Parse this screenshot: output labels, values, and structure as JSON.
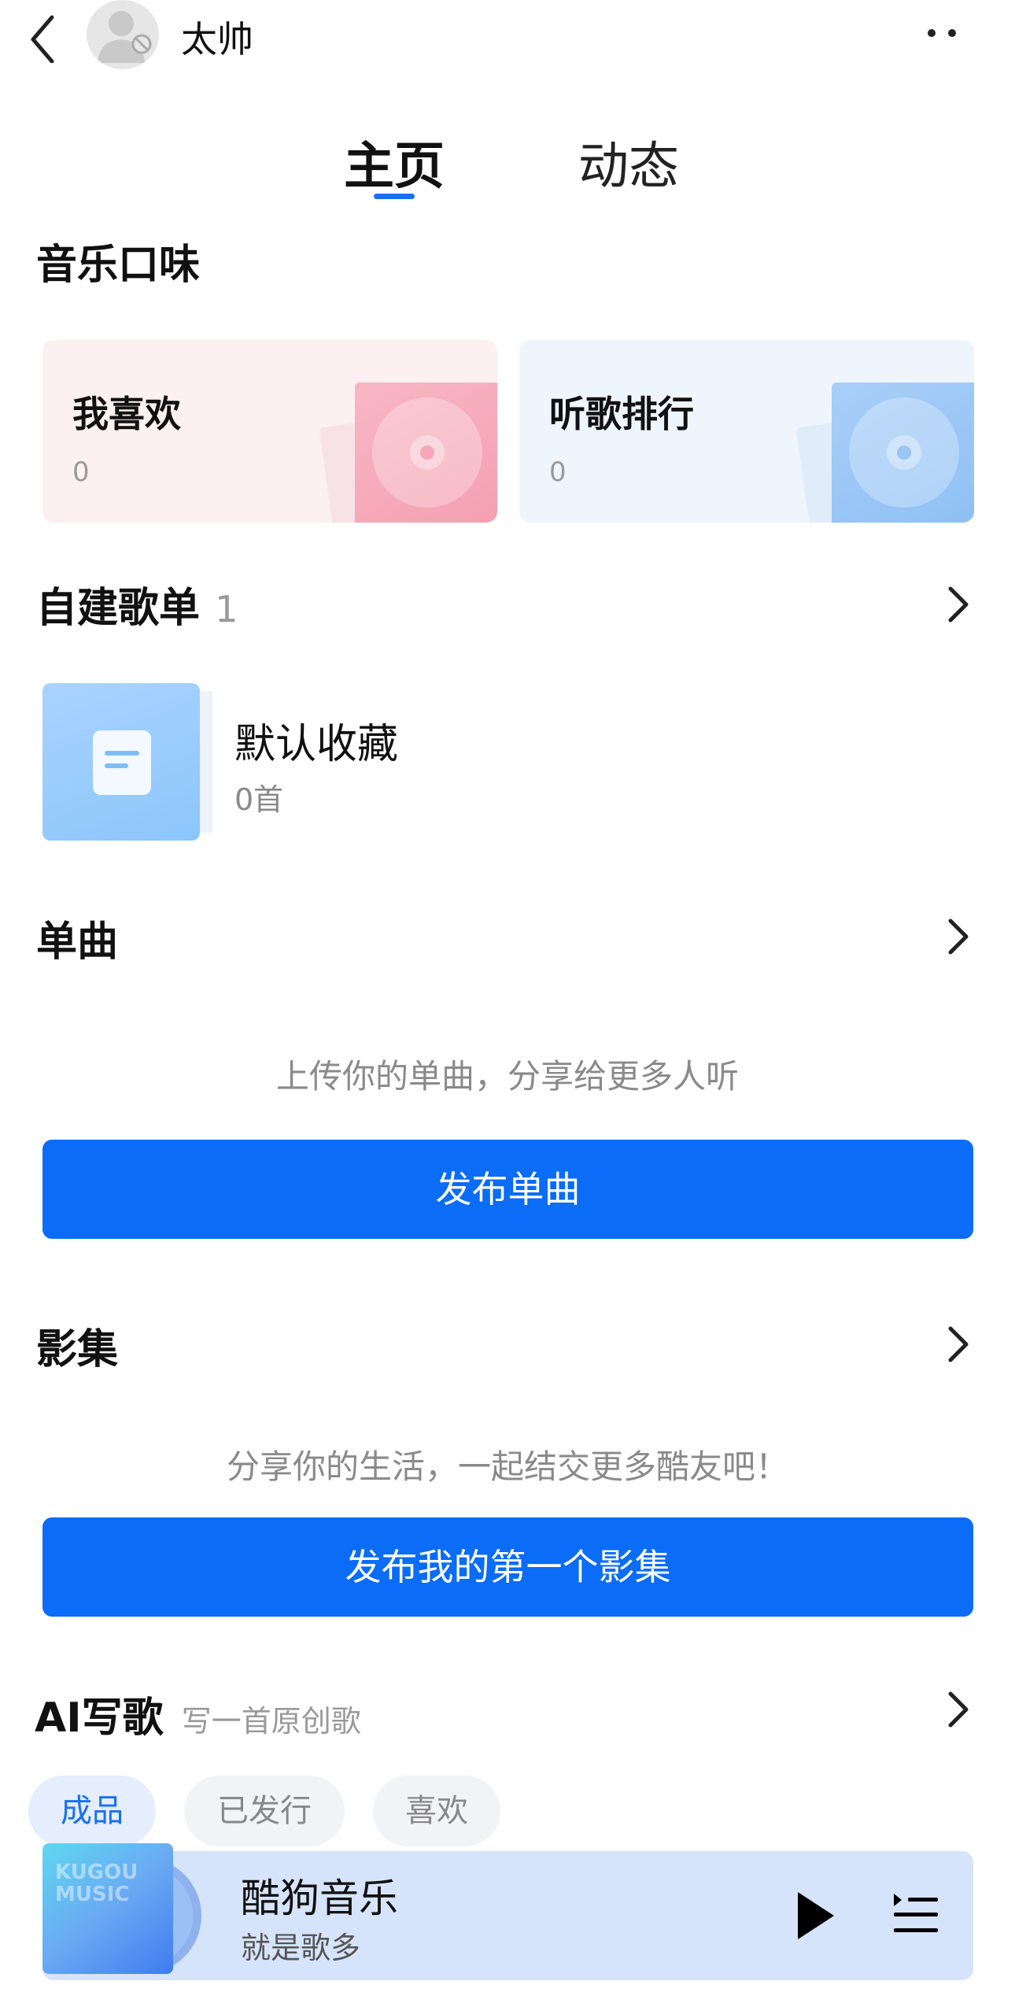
{
  "header": {
    "username": "太帅"
  },
  "tabs": [
    {
      "label": "主页",
      "active": true
    },
    {
      "label": "动态",
      "active": false
    }
  ],
  "taste": {
    "title": "音乐口味",
    "cards": [
      {
        "label": "我喜欢",
        "count": "0",
        "color": "#f4a8b8"
      },
      {
        "label": "听歌排行",
        "count": "0",
        "color": "#9cc8f6"
      }
    ]
  },
  "playlists": {
    "title": "自建歌单",
    "count": "1",
    "items": [
      {
        "name": "默认收藏",
        "tracks": "0首"
      }
    ]
  },
  "singles": {
    "title": "单曲",
    "hint": "上传你的单曲，分享给更多人听",
    "button": "发布单曲"
  },
  "albums": {
    "title": "影集",
    "hint": "分享你的生活，一起结交更多酷友吧！",
    "button": "发布我的第一个影集"
  },
  "ai_song": {
    "title": "AI写歌",
    "subtitle": "写一首原创歌",
    "tabs": [
      "成品",
      "已发行",
      "喜欢"
    ],
    "active_tab": "成品"
  },
  "player": {
    "title": "酷狗音乐",
    "subtitle": "就是歌多",
    "cover_text": [
      "KUGOU",
      "MUSIC"
    ]
  },
  "colors": {
    "accent": "#0a6cf7",
    "tab_indicator": "#1a6ff5"
  }
}
